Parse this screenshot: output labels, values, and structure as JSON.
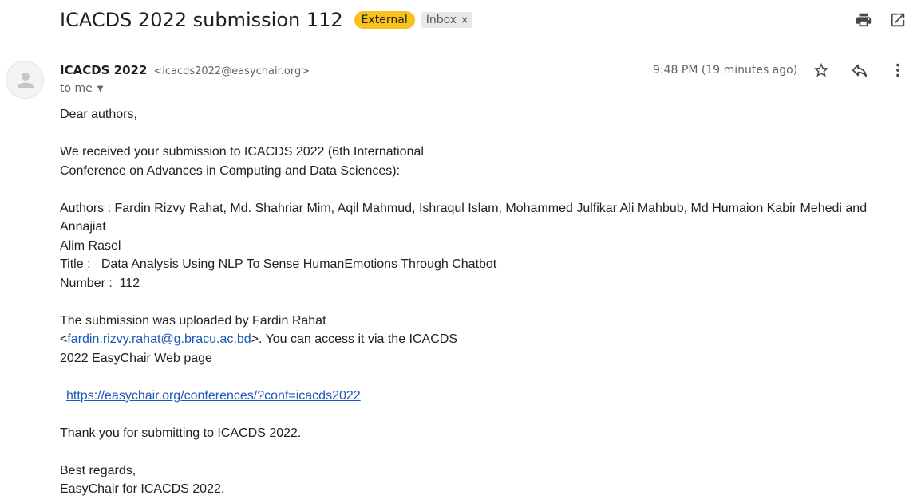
{
  "header": {
    "subject": "ICACDS 2022 submission 112",
    "badge_external": "External",
    "badge_inbox": "Inbox",
    "badge_inbox_close": "×",
    "print_icon": "print-icon",
    "open_new_window_icon": "open-in-new-window-icon"
  },
  "message": {
    "sender_name": "ICACDS 2022",
    "sender_email": "<icacds2022@easychair.org>",
    "recipient": "to me",
    "timestamp": "9:48 PM (19 minutes ago)",
    "actions": [
      "star-icon",
      "reply-icon",
      "more-vert-icon"
    ]
  },
  "body": {
    "greeting": "Dear authors,",
    "intro_line1": "We received your submission to ICACDS 2022 (6th International",
    "intro_line2": "Conference on Advances in Computing and Data Sciences):",
    "authors_line1": "Authors : Fardin Rizvy Rahat, Md. Shahriar Mim, Aqil Mahmud, Ishraqul Islam, Mohammed Julfikar Ali Mahbub, Md Humaion Kabir Mehedi and Annajiat",
    "authors_line2": "Alim Rasel",
    "title_line": "Title :   Data Analysis Using NLP To Sense HumanEmotions Through Chatbot",
    "number_line": "Number :  112",
    "uploaded_line1": "The submission was uploaded by Fardin Rahat",
    "uploaded_lt": "<",
    "uploader_email": "fardin.rizvy.rahat@g.bracu.ac.bd",
    "uploaded_after": ">. You can access it via the ICACDS",
    "uploaded_line3": "2022 EasyChair Web page",
    "conference_link": "https://easychair.org/conferences/?conf=icacds2022",
    "thanks": "Thank you for submitting to ICACDS 2022.",
    "closing": "Best regards,",
    "signature": "EasyChair for ICACDS 2022."
  }
}
